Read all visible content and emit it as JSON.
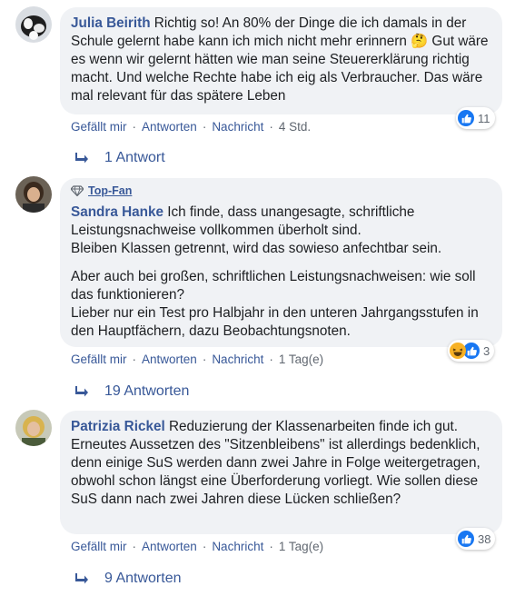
{
  "comments": [
    {
      "author": "Julia Beirith",
      "text": " Richtig so! An 80% der Dinge die ich damals in der Schule gelernt habe kann ich mich nicht mehr erinnern 🤔 Gut wäre es wenn wir gelernt hätten wie man seine Steuererklärung richtig macht. Und welche Rechte habe ich eig als Verbraucher. Das wäre mal relevant für das spätere Leben",
      "actions": {
        "like": "Gefällt mir",
        "reply": "Antworten",
        "message": "Nachricht",
        "time": "4 Std."
      },
      "reaction_count": "11",
      "replies": "1 Antwort"
    },
    {
      "badge": "Top-Fan",
      "author": "Sandra Hanke",
      "para1": " Ich finde, dass unangesagte, schriftliche Leistungsnachweise vollkommen überholt sind.\nBleiben Klassen getrennt, wird das sowieso anfechtbar sein.",
      "para2": "Aber auch bei großen, schriftlichen Leistungsnachweisen: wie soll das funktionieren?\nLieber nur ein Test pro Halbjahr in den unteren Jahrgangsstufen in den Hauptfächern, dazu Beobachtungsnoten.",
      "actions": {
        "like": "Gefällt mir",
        "reply": "Antworten",
        "message": "Nachricht",
        "time": "1 Tag(e)"
      },
      "reaction_count": "3",
      "replies": "19 Antworten"
    },
    {
      "author": "Patrizia Rickel",
      "text": " Reduzierung der Klassenarbeiten finde ich gut. Erneutes Aussetzen des \"Sitzenbleibens\" ist allerdings bedenklich, denn einige SuS werden dann zwei Jahre in Folge weitergetragen, obwohl schon längst eine Überforderung vorliegt. Wie sollen diese SuS dann nach zwei Jahren diese Lücken schließen?",
      "actions": {
        "like": "Gefällt mir",
        "reply": "Antworten",
        "message": "Nachricht",
        "time": "1 Tag(e)"
      },
      "reaction_count": "38",
      "replies": "9 Antworten"
    }
  ],
  "colors": {
    "link": "#385898",
    "bubble": "#f0f2f5",
    "like_blue": "#1877f2",
    "haha_yellow": "#f7b125"
  }
}
